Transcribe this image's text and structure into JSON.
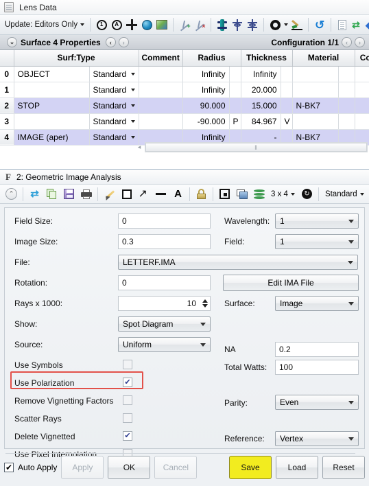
{
  "lens_window": {
    "title": "Lens Data",
    "title_icon": "document-icon",
    "toolbar": {
      "update_label": "Update: Editors Only",
      "icons": [
        "circle-1-icon",
        "circle-a-icon",
        "crosshair-plus-icon",
        "globe-icon",
        "map-layout-icon",
        "insert-surface-icon",
        "delete-surface-icon",
        "3d-layout-icon",
        "shaded-model-icon",
        "aperture-icon",
        "ring-dropdown-icon",
        "paint-brush-icon",
        "undo-arrow-icon",
        "report-icon",
        "swap-green-icon",
        "arrows-blue-icon",
        "dash-blue-icon"
      ]
    },
    "props_bar": {
      "expand_icon": "chevron-down-circle-icon",
      "left_label": "Surface 4 Properties",
      "prev_label": "‹",
      "next_label": "›",
      "right_label": "Configuration 1/1",
      "cfg_prev_label": "‹",
      "cfg_next_label": "›"
    },
    "table": {
      "columns": [
        "",
        "Surf:Type",
        "",
        "Comment",
        "Radius",
        "",
        "Thickness",
        "",
        "Material",
        "",
        "Coating"
      ],
      "headers": {
        "surf_type": "Surf:Type",
        "comment": "Comment",
        "radius": "Radius",
        "thickness": "Thickness",
        "material": "Material",
        "coating": "Coating"
      },
      "rows": [
        {
          "index": "0",
          "name": "OBJECT",
          "type": "Standard",
          "comment": "",
          "radius": "Infinity",
          "radius_flag": "",
          "thickness": "Infinity",
          "thickness_flag": "",
          "material": "",
          "coating": "",
          "selected": false
        },
        {
          "index": "1",
          "name": "",
          "type": "Standard",
          "comment": "",
          "radius": "Infinity",
          "radius_flag": "",
          "thickness": "20.000",
          "thickness_flag": "",
          "material": "",
          "coating": "",
          "selected": false
        },
        {
          "index": "2",
          "name": "STOP",
          "type": "Standard",
          "comment": "",
          "radius": "90.000",
          "radius_flag": "",
          "thickness": "15.000",
          "thickness_flag": "",
          "material": "N-BK7",
          "coating": "",
          "selected": true
        },
        {
          "index": "3",
          "name": "",
          "type": "Standard",
          "comment": "",
          "radius": "-90.000",
          "radius_flag": "P",
          "thickness": "84.967",
          "thickness_flag": "V",
          "material": "",
          "coating": "",
          "selected": false
        },
        {
          "index": "4",
          "name": "IMAGE (aper)",
          "type": "Standard",
          "comment": "",
          "radius": "Infinity",
          "radius_flag": "",
          "thickness": "-",
          "thickness_flag": "",
          "material": "N-BK7",
          "coating": "",
          "selected": true
        }
      ],
      "scrollbar": {
        "left_arrow": "◂",
        "thumb_grip": "‖"
      }
    },
    "highlight_color": "#e2514a"
  },
  "analysis_window": {
    "title_badge": "F",
    "title": "2: Geometric Image Analysis",
    "toolbar": {
      "icons": [
        "collapse-up-icon",
        "refresh-icon",
        "copy-icon",
        "save-icon",
        "print-icon",
        "pencil-icon",
        "rectangle-icon",
        "arrow-icon",
        "line-icon",
        "text-icon",
        "lock-icon",
        "fit-window-icon",
        "detach-window-icon",
        "layers-icon"
      ],
      "grid_label": "3 x 4",
      "reset_icon": "reset-clock-icon",
      "style_label": "Standard",
      "help_icon": "help-icon"
    },
    "form": {
      "left": [
        {
          "label": "Field Size:",
          "kind": "text",
          "value": "0"
        },
        {
          "label": "Image Size:",
          "kind": "text",
          "value": "0.3"
        },
        {
          "label": "File:",
          "kind": "combo",
          "value": "LETTERF.IMA"
        },
        {
          "label": "Rotation:",
          "kind": "text",
          "value": "0"
        },
        {
          "label": "Rays x 1000:",
          "kind": "spinner",
          "value": "10"
        },
        {
          "label": "Show:",
          "kind": "combo",
          "value": "Spot Diagram"
        },
        {
          "label": "Source:",
          "kind": "combo",
          "value": "Uniform"
        },
        {
          "label": "Use Symbols",
          "kind": "checkbox",
          "checked": false
        },
        {
          "label": "Use Polarization",
          "kind": "checkbox",
          "checked": true,
          "highlighted": true
        },
        {
          "label": "Remove Vignetting Factors",
          "kind": "checkbox",
          "checked": false
        },
        {
          "label": "Scatter Rays",
          "kind": "checkbox",
          "checked": false
        },
        {
          "label": "Delete Vignetted",
          "kind": "checkbox",
          "checked": true
        },
        {
          "label": "Use Pixel Interpolation",
          "kind": "checkbox",
          "checked": false
        }
      ],
      "right": [
        {
          "label": "Wavelength:",
          "kind": "combo",
          "value": "1"
        },
        {
          "label": "Field:",
          "kind": "combo",
          "value": "1"
        },
        {
          "label": "",
          "kind": "button",
          "value": "Edit IMA File"
        },
        {
          "label": "Surface:",
          "kind": "combo",
          "value": "Image"
        },
        {
          "label": "NA",
          "kind": "text",
          "value": "0.2"
        },
        {
          "label": "Total Watts:",
          "kind": "text",
          "value": "100"
        },
        {
          "label": "Parity:",
          "kind": "combo",
          "value": "Even"
        },
        {
          "label": "Reference:",
          "kind": "combo",
          "value": "Vertex"
        }
      ]
    },
    "buttons": {
      "auto_apply_label": "Auto Apply",
      "auto_apply_checked": true,
      "apply": "Apply",
      "ok": "OK",
      "cancel": "Cancel",
      "save": "Save",
      "load": "Load",
      "reset": "Reset",
      "save_highlight_color": "#f2ec1f"
    }
  }
}
